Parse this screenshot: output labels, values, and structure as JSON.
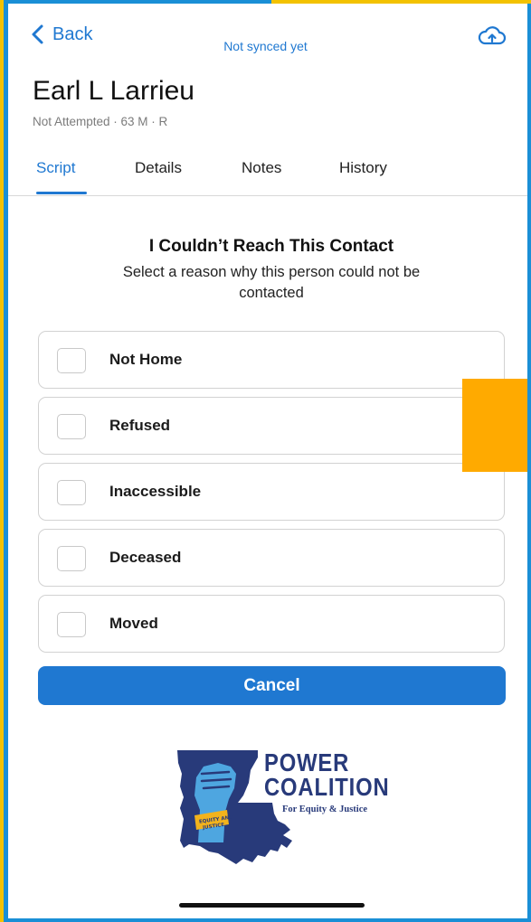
{
  "header": {
    "back_label": "Back",
    "sync_status": "Not synced yet",
    "cloud_icon": "cloud-upload-icon"
  },
  "contact": {
    "name": "Earl L Larrieu",
    "meta": "Not Attempted · 63 M · R"
  },
  "tabs": [
    {
      "label": "Script",
      "active": true
    },
    {
      "label": "Details",
      "active": false
    },
    {
      "label": "Notes",
      "active": false
    },
    {
      "label": "History",
      "active": false
    }
  ],
  "dialog": {
    "title": "I Couldn’t Reach This Contact",
    "subtitle": "Select a reason why this person could not be contacted",
    "options": [
      {
        "label": "Not Home",
        "checked": false
      },
      {
        "label": "Refused",
        "checked": false
      },
      {
        "label": "Inaccessible",
        "checked": false
      },
      {
        "label": "Deceased",
        "checked": false
      },
      {
        "label": "Moved",
        "checked": false
      }
    ],
    "cancel_label": "Cancel"
  },
  "logo": {
    "line1": "POWER",
    "line2": "COALITION",
    "line3": "For Equity & Justice",
    "band_text": "EQUITY AND JUSTICE"
  },
  "colors": {
    "accent": "#1f78d1",
    "frame": "#1a8fd6",
    "frame_accent": "#f3c200",
    "overlay_block": "#ffaa00",
    "logo_navy": "#283a7a",
    "logo_light_blue": "#4ea6e0"
  }
}
